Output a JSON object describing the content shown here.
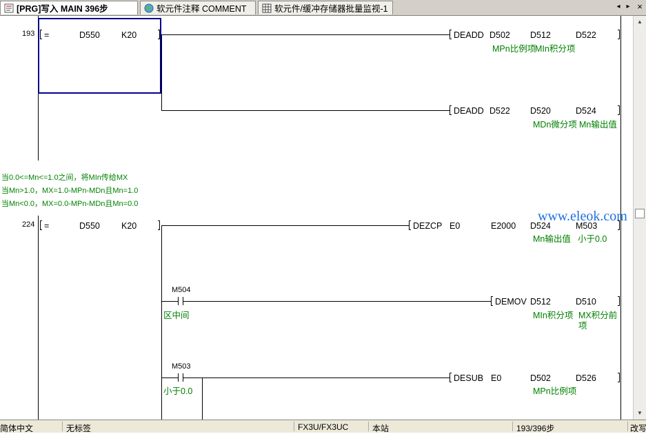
{
  "tabs": [
    {
      "label": "[PRG]写入 MAIN 396步",
      "active": true,
      "icon": "program-icon"
    },
    {
      "label": "软元件注释 COMMENT",
      "active": false,
      "icon": "comment-globe-icon"
    },
    {
      "label": "软元件/缓冲存储器批量监视-1",
      "active": false,
      "icon": "monitor-grid-icon"
    }
  ],
  "nav": {
    "prev": "◂",
    "next": "▸",
    "close": "×"
  },
  "rungs": {
    "r193": {
      "step": "193",
      "cmp": {
        "op": "=",
        "a": "D550",
        "b": "K20"
      },
      "ins1": {
        "name": "DEADD",
        "s1": "D502",
        "s2": "D512",
        "d": "D522",
        "c1": "MPn比例项",
        "c2": "MIn积分项"
      },
      "ins2": {
        "name": "DEADD",
        "s1": "D522",
        "s2": "D520",
        "d": "D524",
        "c1": "MDn微分项",
        "c2": "Mn输出值"
      }
    },
    "statement": [
      "当0.0<=Mn<=1.0之间，将MIn传给MX",
      "当Mn>1.0，MX=1.0-MPn-MDn且Mn=1.0",
      "当Mn<0.0，MX=0.0-MPn-MDn且Mn=0.0"
    ],
    "r224": {
      "step": "224",
      "cmp": {
        "op": "=",
        "a": "D550",
        "b": "K20"
      },
      "zcp": {
        "name": "DEZCP",
        "s1": "E0",
        "s2": "E2000",
        "s3": "D524",
        "d": "M503",
        "c1": "Mn输出值",
        "c2": "小于0.0"
      },
      "contact1": {
        "device": "M504",
        "comment": "区中间"
      },
      "mov": {
        "name": "DEMOV",
        "s": "D512",
        "d": "D510",
        "c1": "MIn积分项",
        "c2a": "MX积分前",
        "c2b": "项"
      },
      "contact2": {
        "device": "M503",
        "comment": "小于0.0"
      },
      "sub": {
        "name": "DESUB",
        "s1": "E0",
        "s2": "D502",
        "d": "D526",
        "c1": "MPn比例项"
      }
    }
  },
  "watermark": "www.eleok.com",
  "scrollbar": {
    "up": "▲",
    "down": "▼"
  },
  "status": {
    "language": "简体中文",
    "label": "无标签",
    "plc": "FX3U/FX3UC",
    "station": "本站",
    "steps": "193/396步",
    "mode": "改写"
  },
  "colors": {
    "comment": "#008000",
    "cursor": "#00008b",
    "watermark": "#1e6fe0",
    "tab_bg": "#d4d0c8"
  }
}
